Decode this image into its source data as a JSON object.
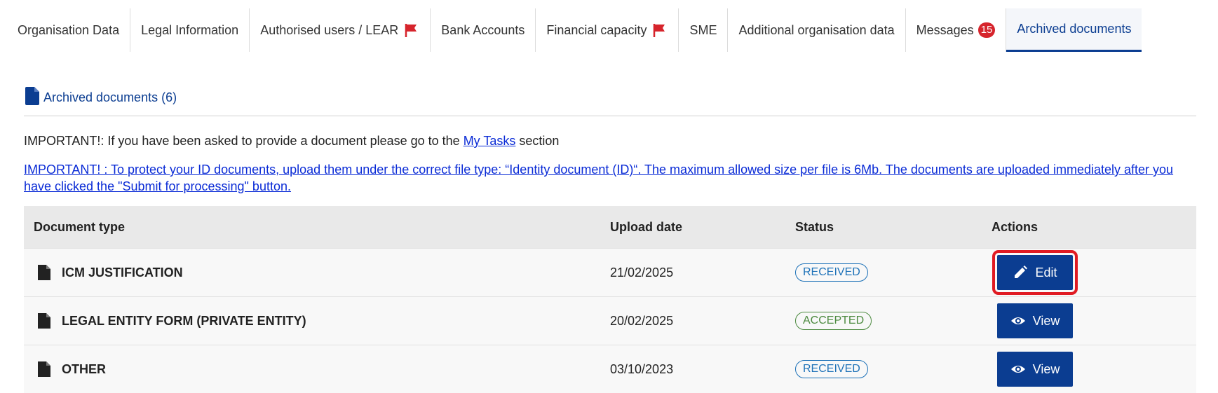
{
  "tabs": [
    {
      "label": "Organisation Data",
      "active": false
    },
    {
      "label": "Legal Information",
      "active": false
    },
    {
      "label": "Authorised users / LEAR",
      "active": false,
      "flag": true
    },
    {
      "label": "Bank Accounts",
      "active": false
    },
    {
      "label": "Financial capacity",
      "active": false,
      "flag": true
    },
    {
      "label": "SME",
      "active": false
    },
    {
      "label": "Additional organisation data",
      "active": false
    },
    {
      "label": "Messages",
      "active": false,
      "badge": "15"
    },
    {
      "label": "Archived documents",
      "active": true
    }
  ],
  "section": {
    "title": "Archived documents (6)"
  },
  "notes": {
    "note1_prefix": "IMPORTANT!: If you have been asked to provide a document please go to the ",
    "note1_link": "My Tasks",
    "note1_suffix": " section",
    "note2_link": "IMPORTANT! : To protect your ID documents, upload them under the correct file type: “Identity document (ID)“. The maximum allowed size per file is 6Mb. The documents are uploaded immediately after you have clicked the \"Submit for processing\" button."
  },
  "table": {
    "headers": {
      "doc_type": "Document type",
      "upload_date": "Upload date",
      "status": "Status",
      "actions": "Actions"
    },
    "rows": [
      {
        "doc_type": "ICM JUSTIFICATION",
        "upload_date": "21/02/2025",
        "status": "RECEIVED",
        "action": "Edit"
      },
      {
        "doc_type": "LEGAL ENTITY FORM (PRIVATE ENTITY)",
        "upload_date": "20/02/2025",
        "status": "ACCEPTED",
        "action": "View"
      },
      {
        "doc_type": "OTHER",
        "upload_date": "03/10/2023",
        "status": "RECEIVED",
        "action": "View"
      }
    ]
  },
  "colors": {
    "accent": "#0b3d91",
    "flag": "#d6242c",
    "received": "#1e72b8",
    "accepted": "#4c8a3f",
    "highlight": "#e01b23"
  }
}
